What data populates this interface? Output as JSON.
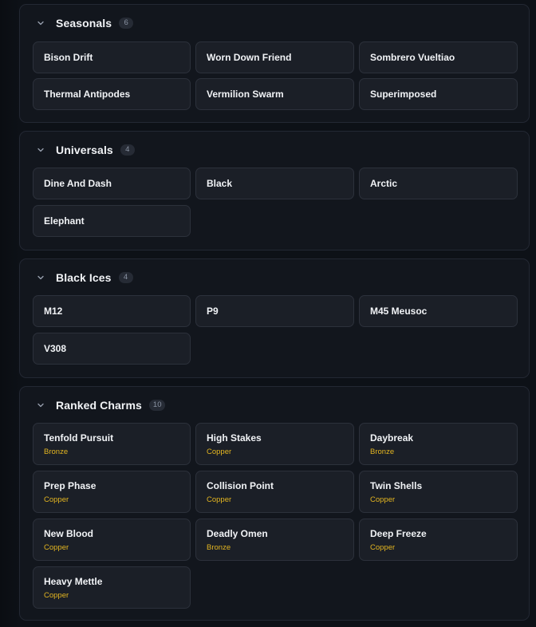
{
  "colors": {
    "background": "#0d1117",
    "panel": "#12161d",
    "card": "#1b1f27",
    "tier_text": "#e3b520"
  },
  "sections": [
    {
      "title": "Seasonals",
      "count": "6",
      "icon": "chevron-down-icon",
      "items": [
        {
          "name": "Bison Drift"
        },
        {
          "name": "Worn Down Friend"
        },
        {
          "name": "Sombrero Vueltiao"
        },
        {
          "name": "Thermal Antipodes"
        },
        {
          "name": "Vermilion Swarm"
        },
        {
          "name": "Superimposed"
        }
      ]
    },
    {
      "title": "Universals",
      "count": "4",
      "icon": "chevron-down-icon",
      "items": [
        {
          "name": "Dine And Dash"
        },
        {
          "name": "Black"
        },
        {
          "name": "Arctic"
        },
        {
          "name": "Elephant"
        }
      ]
    },
    {
      "title": "Black Ices",
      "count": "4",
      "icon": "chevron-down-icon",
      "items": [
        {
          "name": "M12"
        },
        {
          "name": "P9"
        },
        {
          "name": "M45 Meusoc"
        },
        {
          "name": "V308"
        }
      ]
    },
    {
      "title": "Ranked Charms",
      "count": "10",
      "icon": "chevron-down-icon",
      "items": [
        {
          "name": "Tenfold Pursuit",
          "tier": "Bronze"
        },
        {
          "name": "High Stakes",
          "tier": "Copper"
        },
        {
          "name": "Daybreak",
          "tier": "Bronze"
        },
        {
          "name": "Prep Phase",
          "tier": "Copper"
        },
        {
          "name": "Collision Point",
          "tier": "Copper"
        },
        {
          "name": "Twin Shells",
          "tier": "Copper"
        },
        {
          "name": "New Blood",
          "tier": "Copper"
        },
        {
          "name": "Deadly Omen",
          "tier": "Bronze"
        },
        {
          "name": "Deep Freeze",
          "tier": "Copper"
        },
        {
          "name": "Heavy Mettle",
          "tier": "Copper"
        }
      ]
    }
  ]
}
